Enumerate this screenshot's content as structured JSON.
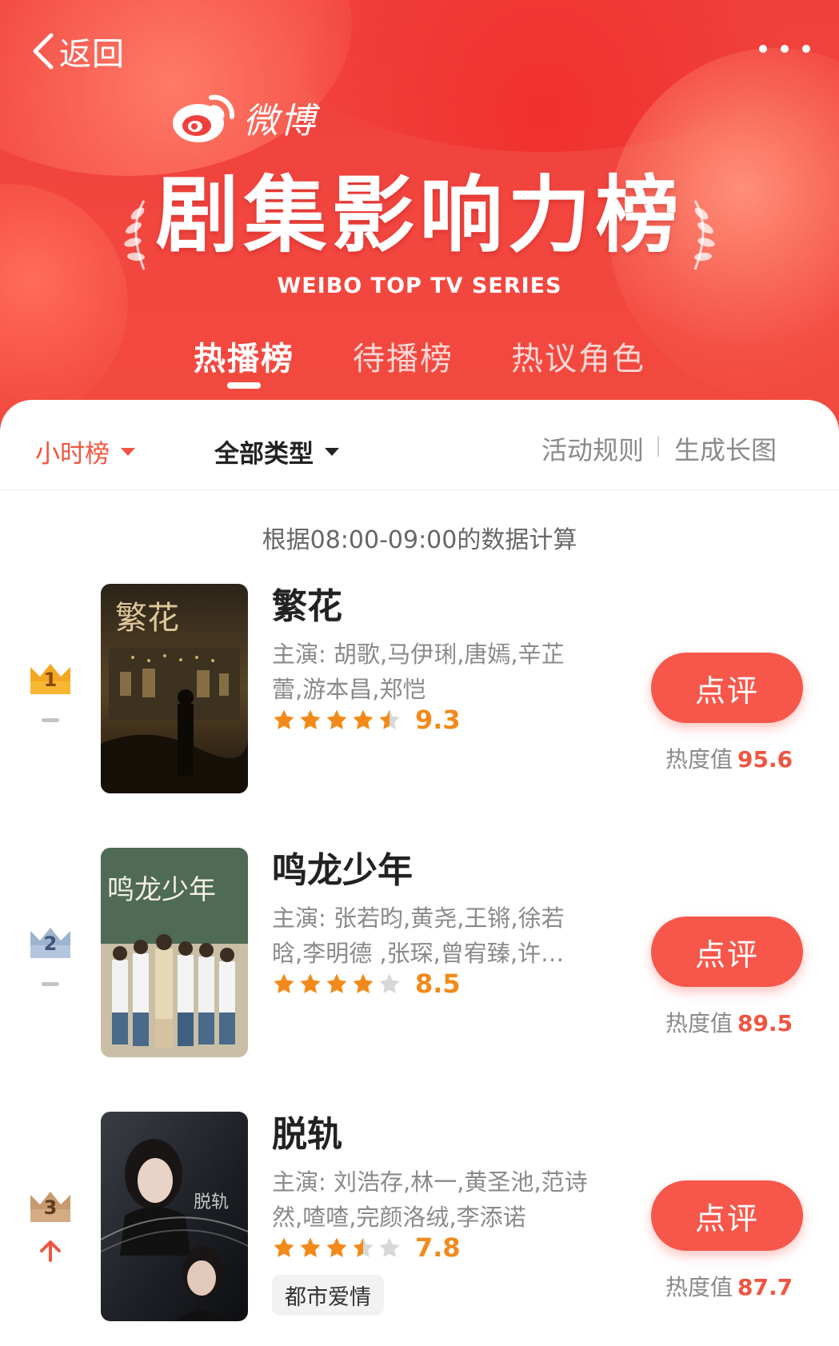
{
  "header": {
    "back_label": "返回",
    "brand": "微博",
    "title": "剧集影响力榜",
    "subtitle": "WEIBO TOP TV SERIES",
    "tabs": [
      {
        "label": "热播榜",
        "active": true
      },
      {
        "label": "待播榜",
        "active": false
      },
      {
        "label": "热议角色",
        "active": false
      }
    ]
  },
  "filters": {
    "period": "小时榜",
    "category": "全部类型",
    "rules": "活动规则",
    "long_image": "生成长图"
  },
  "note": "根据08:00-09:00的数据计算",
  "items": [
    {
      "rank": "1",
      "trend": "flat",
      "title": "繁花",
      "cast": "主演: 胡歌,马伊琍,唐嫣,辛芷蕾,游本昌,郑恺",
      "stars": 4.5,
      "score": "9.3",
      "button": "点评",
      "heat_label": "热度值",
      "heat_value": "95.6",
      "tag": ""
    },
    {
      "rank": "2",
      "trend": "flat",
      "title": "鸣龙少年",
      "cast": "主演: 张若昀,黄尧,王锵,徐若晗,李明德 ,张琛,曾宥臻,许…",
      "stars": 4,
      "score": "8.5",
      "button": "点评",
      "heat_label": "热度值",
      "heat_value": "89.5",
      "tag": ""
    },
    {
      "rank": "3",
      "trend": "up",
      "title": "脱轨",
      "cast": "主演: 刘浩存,林一,黄圣池,范诗然,喳喳,完颜洛绒,李添诺",
      "stars": 3.5,
      "score": "7.8",
      "button": "点评",
      "heat_label": "热度值",
      "heat_value": "87.7",
      "tag": "都市爱情"
    }
  ],
  "colors": {
    "accent": "#f6574a",
    "gold": "#f5a623",
    "silver": "#9db3d0",
    "bronze": "#c79a6e",
    "star": "#f28a1a"
  }
}
